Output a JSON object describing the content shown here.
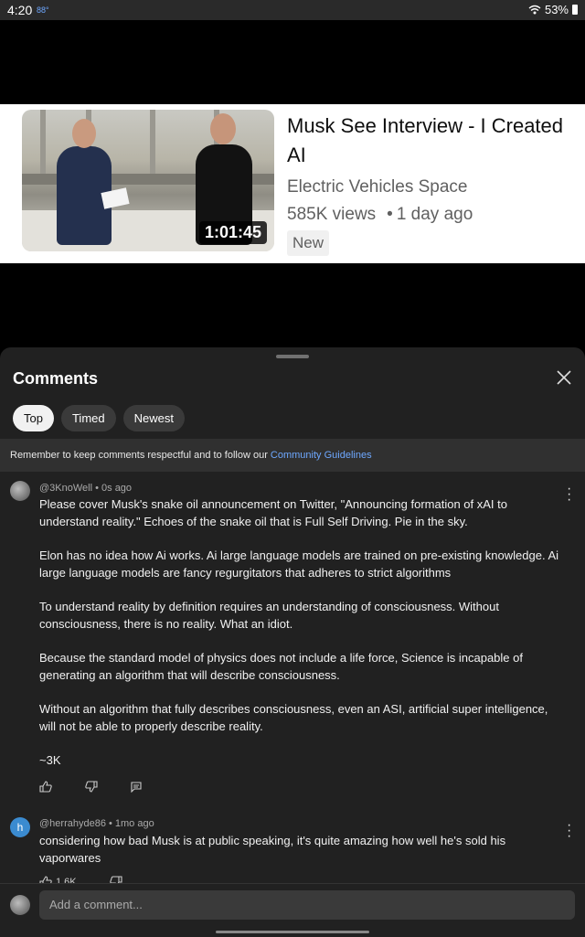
{
  "status_bar": {
    "time": "4:20",
    "temperature": "88°",
    "battery": "53%",
    "icons": [
      "wifi-icon",
      "battery-icon"
    ]
  },
  "video": {
    "title": "Musk See Interview - I Created AI",
    "channel": "Electric Vehicles Space",
    "views": "585K views",
    "age": "1 day ago",
    "badge": "New",
    "duration": "1:01:45"
  },
  "comments_panel": {
    "title": "Comments",
    "chips": [
      {
        "label": "Top",
        "active": true
      },
      {
        "label": "Timed",
        "active": false
      },
      {
        "label": "Newest",
        "active": false
      }
    ],
    "guidelines_text": "Remember to keep comments respectful and to follow our ",
    "guidelines_link": "Community Guidelines",
    "comments": [
      {
        "author": "@3KnoWell",
        "time": "0s ago",
        "paragraphs": [
          "Please cover Musk's snake oil announcement on Twitter, \"Announcing formation of xAI to understand reality.\"  Echoes of the snake oil that is Full Self Driving. Pie in the sky.",
          "Elon has no idea how Ai works. Ai large language models are trained on pre-existing knowledge.  Ai large language models are fancy regurgitators that adheres to strict algorithms",
          "To understand reality by definition requires an understanding of consciousness. Without consciousness, there is no reality. What an idiot.",
          "Because the standard model of physics does not include a life force, Science is incapable of generating an algorithm that will describe consciousness.",
          "Without an algorithm that fully describes consciousness, even an ASI, artificial super intelligence, will not be able to properly describe reality.",
          "~3K"
        ],
        "likes": ""
      },
      {
        "author": "@herrahyde86",
        "time": "1mo ago",
        "avatar_letter": "h",
        "paragraphs": [
          "considering how bad Musk is at public speaking, it's quite amazing how well he's sold his vaporwares"
        ],
        "likes": "1.6K"
      }
    ],
    "add_comment_placeholder": "Add a comment..."
  },
  "colors": {
    "panel_bg": "#212121",
    "link": "#6ea8ff",
    "chip_active": "#f1f1f1"
  }
}
